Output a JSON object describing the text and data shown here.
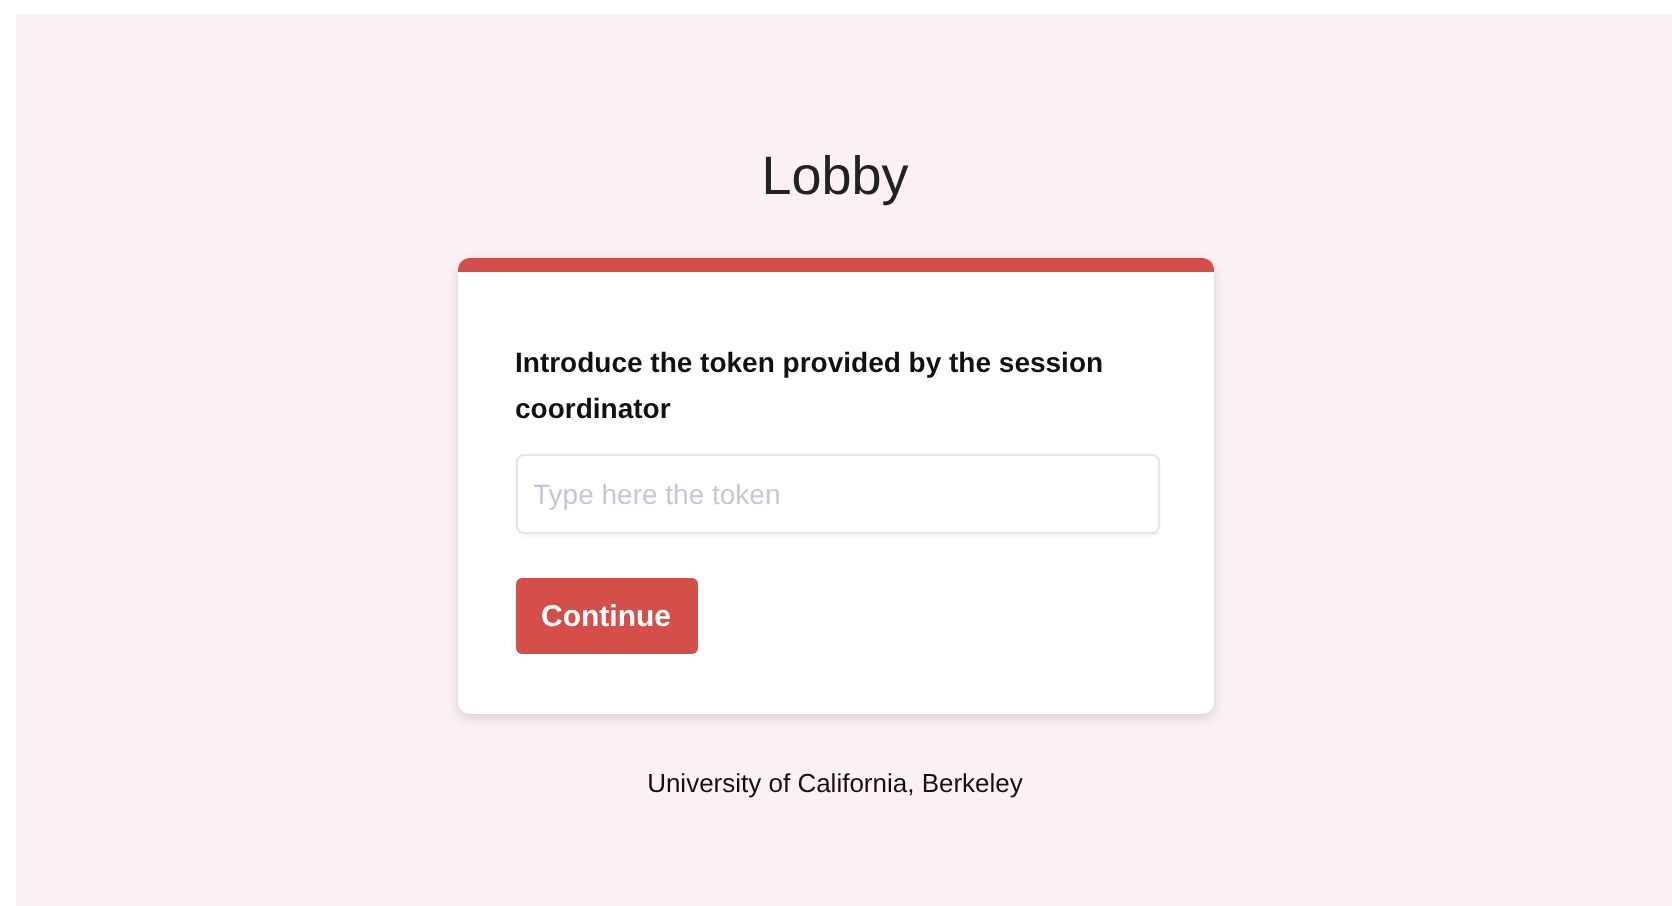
{
  "page_title": "Lobby",
  "form": {
    "label": "Introduce the token provided by the session coordinator",
    "token_field": {
      "placeholder": "Type here the token"
    },
    "submit_button": "Continue"
  },
  "footer": "University of California, Berkeley"
}
